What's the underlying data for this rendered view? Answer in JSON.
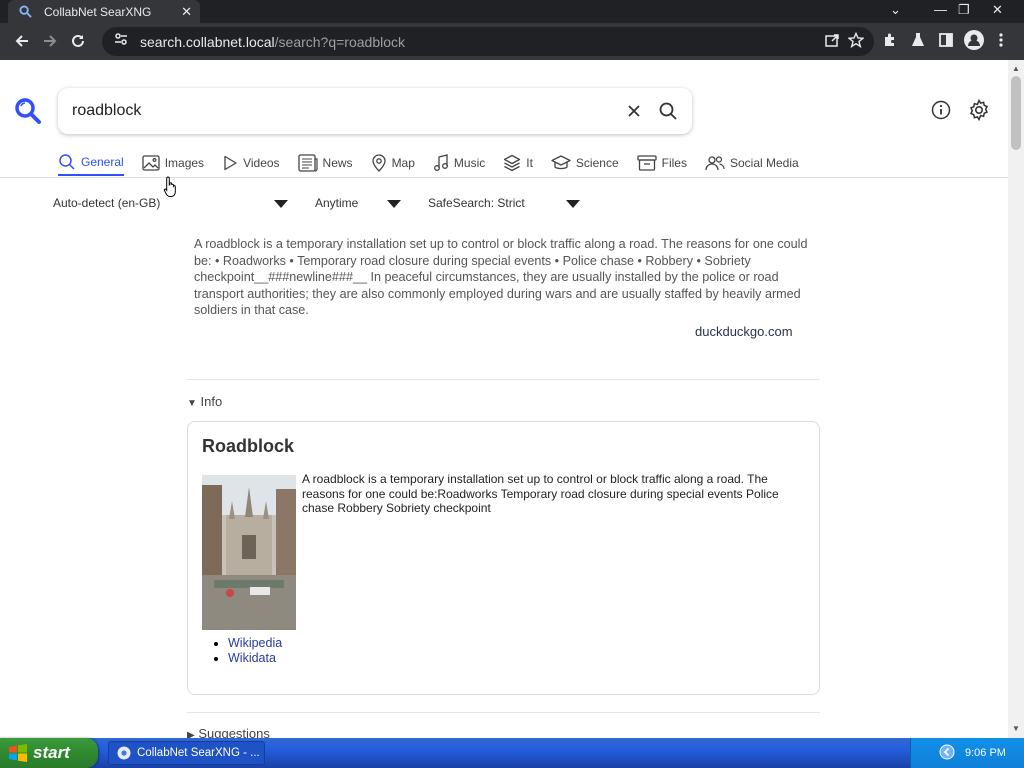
{
  "browser": {
    "tab_title": "CollabNet SearXNG",
    "url_host": "search.collabnet.local",
    "url_path": "/search?q=roadblock"
  },
  "search": {
    "query": "roadblock"
  },
  "categories": [
    {
      "label": "General",
      "icon": "search-icon",
      "active": true
    },
    {
      "label": "Images",
      "icon": "image-icon"
    },
    {
      "label": "Videos",
      "icon": "play-icon"
    },
    {
      "label": "News",
      "icon": "newspaper-icon"
    },
    {
      "label": "Map",
      "icon": "map-pin-icon"
    },
    {
      "label": "Music",
      "icon": "music-note-icon"
    },
    {
      "label": "It",
      "icon": "layers-icon"
    },
    {
      "label": "Science",
      "icon": "graduation-cap-icon"
    },
    {
      "label": "Files",
      "icon": "archive-icon"
    },
    {
      "label": "Social Media",
      "icon": "people-icon"
    }
  ],
  "filters": {
    "language": "Auto-detect (en-GB)",
    "time": "Anytime",
    "safesearch": "SafeSearch: Strict"
  },
  "answer": {
    "text": "A roadblock is a temporary installation set up to control or block traffic along a road. The reasons for one could be: • Roadworks • Temporary road closure during special events • Police chase • Robbery • Sobriety checkpoint__###newline###__ In peaceful circumstances, they are usually installed by the police or road transport authorities; they are also commonly employed during wars and are usually staffed by heavily armed soldiers in that case.",
    "source": "duckduckgo.com"
  },
  "infobox": {
    "toggle_label": "Info",
    "title": "Roadblock",
    "text": "A roadblock is a temporary installation set up to control or block traffic along a road. The reasons for one could be:Roadworks Temporary road closure during special events Police chase Robbery Sobriety checkpoint",
    "links": [
      "Wikipedia",
      "Wikidata"
    ]
  },
  "suggestions": {
    "toggle_label": "Suggestions"
  },
  "taskbar": {
    "start_label": "start",
    "task_label": "CollabNet SearXNG - ...",
    "clock": "9:06 PM"
  },
  "colors": {
    "accent": "#3050ff",
    "link": "#2a3a9a"
  }
}
